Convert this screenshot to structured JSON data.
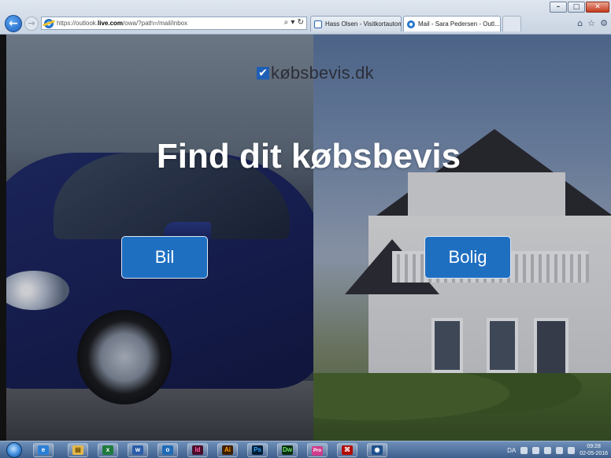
{
  "browser": {
    "url_prefix": "https://outlook.",
    "url_domain": "live.com",
    "url_suffix": "/owa/?path=/mail/inbox",
    "address_tools": "⌕ ▾ ↻",
    "tabs": [
      {
        "label": "Hass Olsen - Visitkortautomat"
      },
      {
        "label": "Mail - Sara Pedersen - Outl...",
        "close": "✕"
      }
    ],
    "window_controls": {
      "minimize": "–",
      "maximize": "□",
      "close": "✕"
    },
    "toolbar_icons": {
      "home": "⌂",
      "favorites": "☆",
      "settings": "⚙"
    }
  },
  "page": {
    "logo": {
      "check": "✔",
      "name": "købsbevis",
      "suffix": ".dk"
    },
    "headline": "Find dit købsbevis",
    "buttons": {
      "bil": "Bil",
      "bolig": "Bolig"
    }
  },
  "taskbar": {
    "apps": [
      {
        "name": "ie",
        "glyph": "e"
      },
      {
        "name": "explorer",
        "glyph": "▤"
      },
      {
        "name": "excel",
        "glyph": "x"
      },
      {
        "name": "word",
        "glyph": "w"
      },
      {
        "name": "outlook",
        "glyph": "o"
      },
      {
        "name": "indesign",
        "glyph": "Id"
      },
      {
        "name": "illustrator",
        "glyph": "Ai"
      },
      {
        "name": "photoshop",
        "glyph": "Ps"
      },
      {
        "name": "dreamweaver",
        "glyph": "Dw"
      },
      {
        "name": "app-pro",
        "glyph": "Pro"
      },
      {
        "name": "acrobat",
        "glyph": "⌘"
      },
      {
        "name": "media",
        "glyph": "◉"
      }
    ],
    "tray": {
      "language": "DA",
      "time": "09:28",
      "date": "02-05-2016"
    }
  }
}
